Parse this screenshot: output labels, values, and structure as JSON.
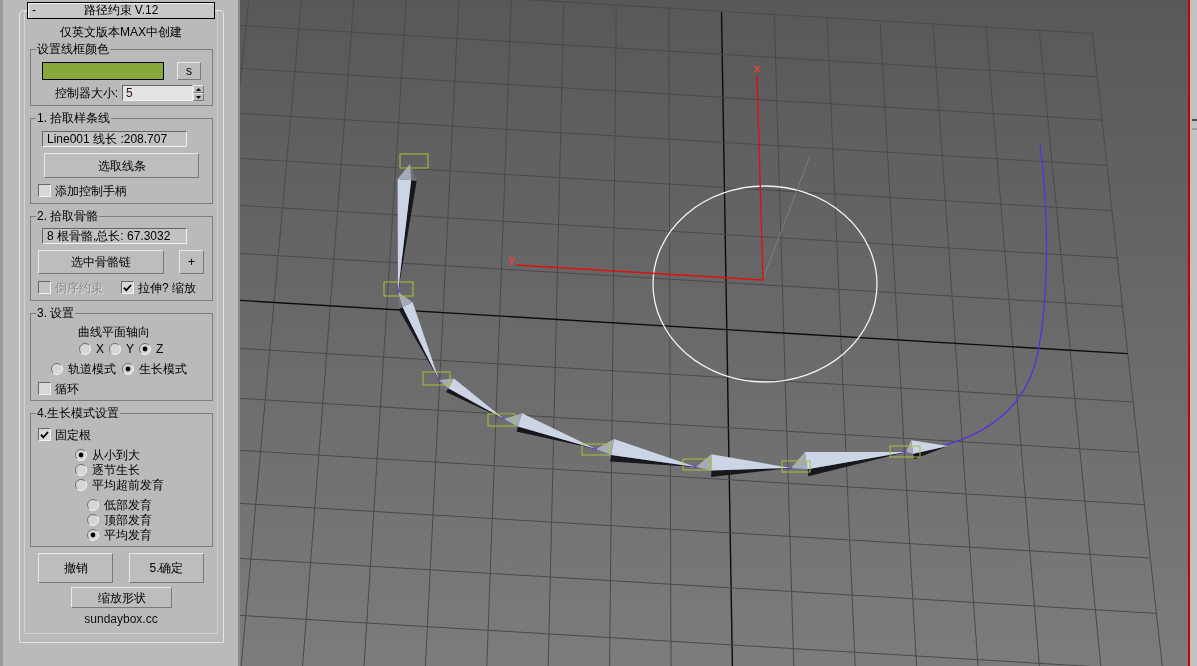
{
  "rollout": {
    "toggle": "-",
    "title": "路径约束 V.12"
  },
  "note": "仅英文版本MAX中创建",
  "wireframe_group": {
    "title": "设置线框颜色",
    "swatch": {
      "color": "#89a83b"
    },
    "swatch_button": "s",
    "size_label": "控制器大小:",
    "size_value": "5"
  },
  "spline_group": {
    "title": "1. 拾取样条线",
    "info": "Line001 线长 :208.707",
    "pick_button": "选取线条",
    "checkboxes": [
      {
        "label": "添加控制手柄",
        "checked": false,
        "disabled": false
      }
    ]
  },
  "bones_group": {
    "title": "2. 拾取骨骼",
    "info": "8 根骨骼,总长: 67.3032",
    "pick_button": "选中骨骼链",
    "add_button": "+",
    "checkboxes": [
      {
        "label": "倒序约束",
        "checked": false,
        "disabled": true
      },
      {
        "label": "拉伸? 缩放",
        "checked": true,
        "disabled": false
      }
    ]
  },
  "settings_group": {
    "title": "3. 设置",
    "axis_label": "曲线平面轴向",
    "axes": [
      {
        "label": "X",
        "selected": false
      },
      {
        "label": "Y",
        "selected": false
      },
      {
        "label": "Z",
        "selected": true
      }
    ],
    "modes": [
      {
        "label": "轨道模式",
        "selected": false
      },
      {
        "label": "生长模式",
        "selected": true
      }
    ],
    "checkboxes": [
      {
        "label": "循环",
        "checked": false,
        "disabled": false
      }
    ]
  },
  "growth_group": {
    "title": "4.生长模式设置",
    "checkboxes": [
      {
        "label": "固定根",
        "checked": true,
        "disabled": false
      }
    ],
    "growth_types": [
      {
        "label": "从小到大",
        "selected": true
      },
      {
        "label": "逐节生长",
        "selected": false
      },
      {
        "label": "平均超前发育",
        "selected": false
      }
    ],
    "development": [
      {
        "label": "低部发育",
        "selected": false
      },
      {
        "label": "顶部发育",
        "selected": false
      },
      {
        "label": "平均发育",
        "selected": true
      }
    ]
  },
  "actions": [
    "撤销",
    "5.确定"
  ],
  "scale_button": "缩放形状",
  "footer": "sundaybox.cc",
  "viewport": {
    "x_axis_label": "x",
    "y_axis_label": "y"
  }
}
